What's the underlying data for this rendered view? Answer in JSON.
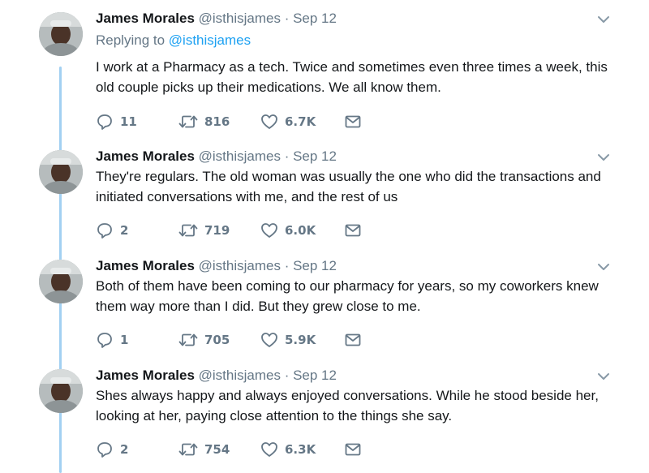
{
  "tweets": [
    {
      "name": "James Morales",
      "meta": "@isthisjames · Sep 12",
      "reply_prefix": "Replying to ",
      "reply_handle": "@isthisjames",
      "text": "I work at a Pharmacy as a tech. Twice and sometimes even three times a week, this old couple picks up their medications. We all know them.",
      "replies": "11",
      "retweets": "816",
      "likes": "6.7K"
    },
    {
      "name": "James Morales",
      "meta": "@isthisjames · Sep 12",
      "text": "They're regulars. The old woman was usually the one who did the transactions and initiated conversations with me, and the rest of us",
      "replies": "2",
      "retweets": "719",
      "likes": "6.0K"
    },
    {
      "name": "James Morales",
      "meta": "@isthisjames · Sep 12",
      "text": "Both of them have been coming to our pharmacy for years, so my coworkers knew them way more than I did. But they grew close to me.",
      "replies": "1",
      "retweets": "705",
      "likes": "5.9K"
    },
    {
      "name": "James Morales",
      "meta": "@isthisjames · Sep 12",
      "text": "Shes always happy and always enjoyed conversations. While he stood beside her, looking at her, paying close attention to the things she say.",
      "replies": "2",
      "retweets": "754",
      "likes": "6.3K"
    }
  ],
  "icons": {
    "reply": "reply-icon",
    "retweet": "retweet-icon",
    "like": "heart-icon",
    "dm": "envelope-icon",
    "menu": "chevron-down-icon"
  },
  "colors": {
    "link": "#1da1f2",
    "muted": "#657786",
    "thread_line": "#a2d0f2"
  }
}
